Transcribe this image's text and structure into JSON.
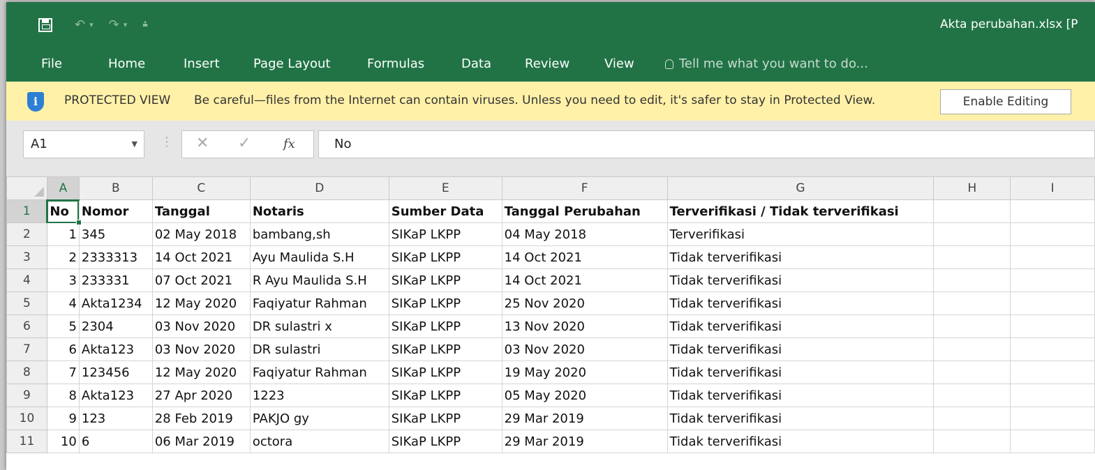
{
  "app": {
    "doc_title": "Akta perubahan.xlsx  [P",
    "qat": {
      "undo": "↶",
      "redo": "↷",
      "dropdown": "▾",
      "customize": "⩮"
    }
  },
  "ribbon": {
    "tabs": [
      "File",
      "Home",
      "Insert",
      "Page Layout",
      "Formulas",
      "Data",
      "Review",
      "View"
    ],
    "tell_me": "Tell me what you want to do..."
  },
  "protected_view": {
    "label": "PROTECTED VIEW",
    "message": "Be careful—files from the Internet can contain viruses. Unless you need to edit, it's safer to stay in Protected View.",
    "button": "Enable Editing"
  },
  "formula_bar": {
    "name_box": "A1",
    "cancel": "✕",
    "enter": "✓",
    "fx": "fx",
    "content": "No"
  },
  "sheet": {
    "columns": [
      "A",
      "B",
      "C",
      "D",
      "E",
      "F",
      "G",
      "H",
      "I"
    ],
    "header_row": {
      "row": "1",
      "cells": [
        "No",
        "Nomor",
        "Tanggal",
        "Notaris",
        "Sumber Data",
        "Tanggal Perubahan",
        "Terverifikasi / Tidak terverifikasi",
        "",
        ""
      ]
    },
    "rows": [
      {
        "row": "2",
        "cells": [
          "1",
          "345",
          "02 May 2018",
          "bambang,sh",
          "SIKaP LKPP",
          "04 May 2018",
          "Terverifikasi",
          "",
          ""
        ]
      },
      {
        "row": "3",
        "cells": [
          "2",
          "2333313",
          "14 Oct 2021",
          "Ayu Maulida S.H",
          "SIKaP LKPP",
          "14 Oct 2021",
          "Tidak terverifikasi",
          "",
          ""
        ]
      },
      {
        "row": "4",
        "cells": [
          "3",
          "233331",
          "07 Oct 2021",
          "R Ayu Maulida S.H",
          "SIKaP LKPP",
          "14 Oct 2021",
          "Tidak terverifikasi",
          "",
          ""
        ]
      },
      {
        "row": "5",
        "cells": [
          "4",
          "Akta1234",
          "12 May 2020",
          "Faqiyatur Rahman",
          "SIKaP LKPP",
          "25 Nov 2020",
          "Tidak terverifikasi",
          "",
          ""
        ]
      },
      {
        "row": "6",
        "cells": [
          "5",
          "2304",
          "03 Nov 2020",
          "DR sulastri x",
          "SIKaP LKPP",
          "13 Nov 2020",
          "Tidak terverifikasi",
          "",
          ""
        ]
      },
      {
        "row": "7",
        "cells": [
          "6",
          "Akta123",
          "03 Nov 2020",
          "DR sulastri",
          "SIKaP LKPP",
          "03 Nov 2020",
          "Tidak terverifikasi",
          "",
          ""
        ]
      },
      {
        "row": "8",
        "cells": [
          "7",
          "123456",
          "12 May 2020",
          "Faqiyatur Rahman",
          "SIKaP LKPP",
          "19 May 2020",
          "Tidak terverifikasi",
          "",
          ""
        ]
      },
      {
        "row": "9",
        "cells": [
          "8",
          "Akta123",
          "27 Apr 2020",
          "1223",
          "SIKaP LKPP",
          "05 May 2020",
          "Tidak terverifikasi",
          "",
          ""
        ]
      },
      {
        "row": "10",
        "cells": [
          "9",
          "123",
          "28 Feb 2019",
          "PAKJO gy",
          "SIKaP LKPP",
          "29 Mar 2019",
          "Tidak terverifikasi",
          "",
          ""
        ]
      },
      {
        "row": "11",
        "cells": [
          "10",
          "6",
          "06 Mar 2019",
          "octora",
          "SIKaP LKPP",
          "29 Mar 2019",
          "Tidak terverifikasi",
          "",
          ""
        ]
      }
    ]
  },
  "colors": {
    "excel_green": "#217346",
    "protected_bar": "#fff1a8",
    "shield_blue": "#2d7fd3"
  }
}
